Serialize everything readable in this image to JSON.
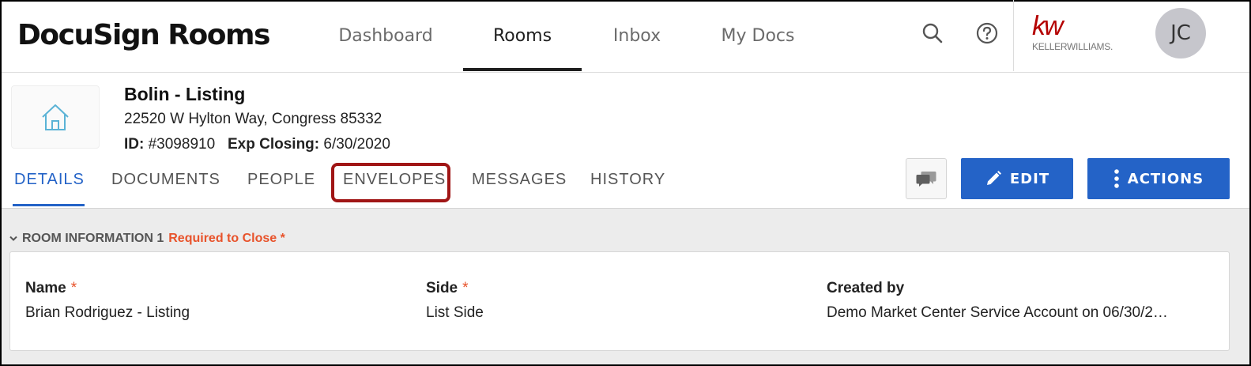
{
  "app": {
    "logo": "DocuSign Rooms"
  },
  "nav": {
    "items": [
      {
        "label": "Dashboard"
      },
      {
        "label": "Rooms"
      },
      {
        "label": "Inbox"
      },
      {
        "label": "My Docs"
      }
    ],
    "active": "Rooms"
  },
  "header_icons": {
    "search": "search-icon",
    "help": "help-icon"
  },
  "brand": {
    "mark": "kw",
    "text": "KELLERWILLIAMS."
  },
  "user": {
    "initials": "JC"
  },
  "room": {
    "title": "Bolin - Listing",
    "address": "22520 W Hylton Way, Congress 85332",
    "id_label": "ID:",
    "id_value": "#3098910",
    "closing_label": "Exp Closing:",
    "closing_value": "6/30/2020"
  },
  "tabs": [
    {
      "label": "DETAILS"
    },
    {
      "label": "DOCUMENTS"
    },
    {
      "label": "PEOPLE"
    },
    {
      "label": "ENVELOPES"
    },
    {
      "label": "MESSAGES"
    },
    {
      "label": "HISTORY"
    }
  ],
  "active_tab": "DETAILS",
  "highlighted_tab": "ENVELOPES",
  "buttons": {
    "edit": "EDIT",
    "actions": "ACTIONS"
  },
  "section": {
    "title": "ROOM INFORMATION 1",
    "required": "Required to Close *"
  },
  "fields": [
    {
      "label": "Name",
      "required": "*",
      "value": "Brian Rodriguez - Listing"
    },
    {
      "label": "Side",
      "required": "*",
      "value": "List Side"
    },
    {
      "label": "Created by",
      "required": "",
      "value": "Demo Market Center Service Account on 06/30/2…"
    }
  ],
  "colors": {
    "accent": "#2463c7",
    "required": "#e8532b",
    "highlight": "#a01515",
    "brand": "#b40101"
  }
}
